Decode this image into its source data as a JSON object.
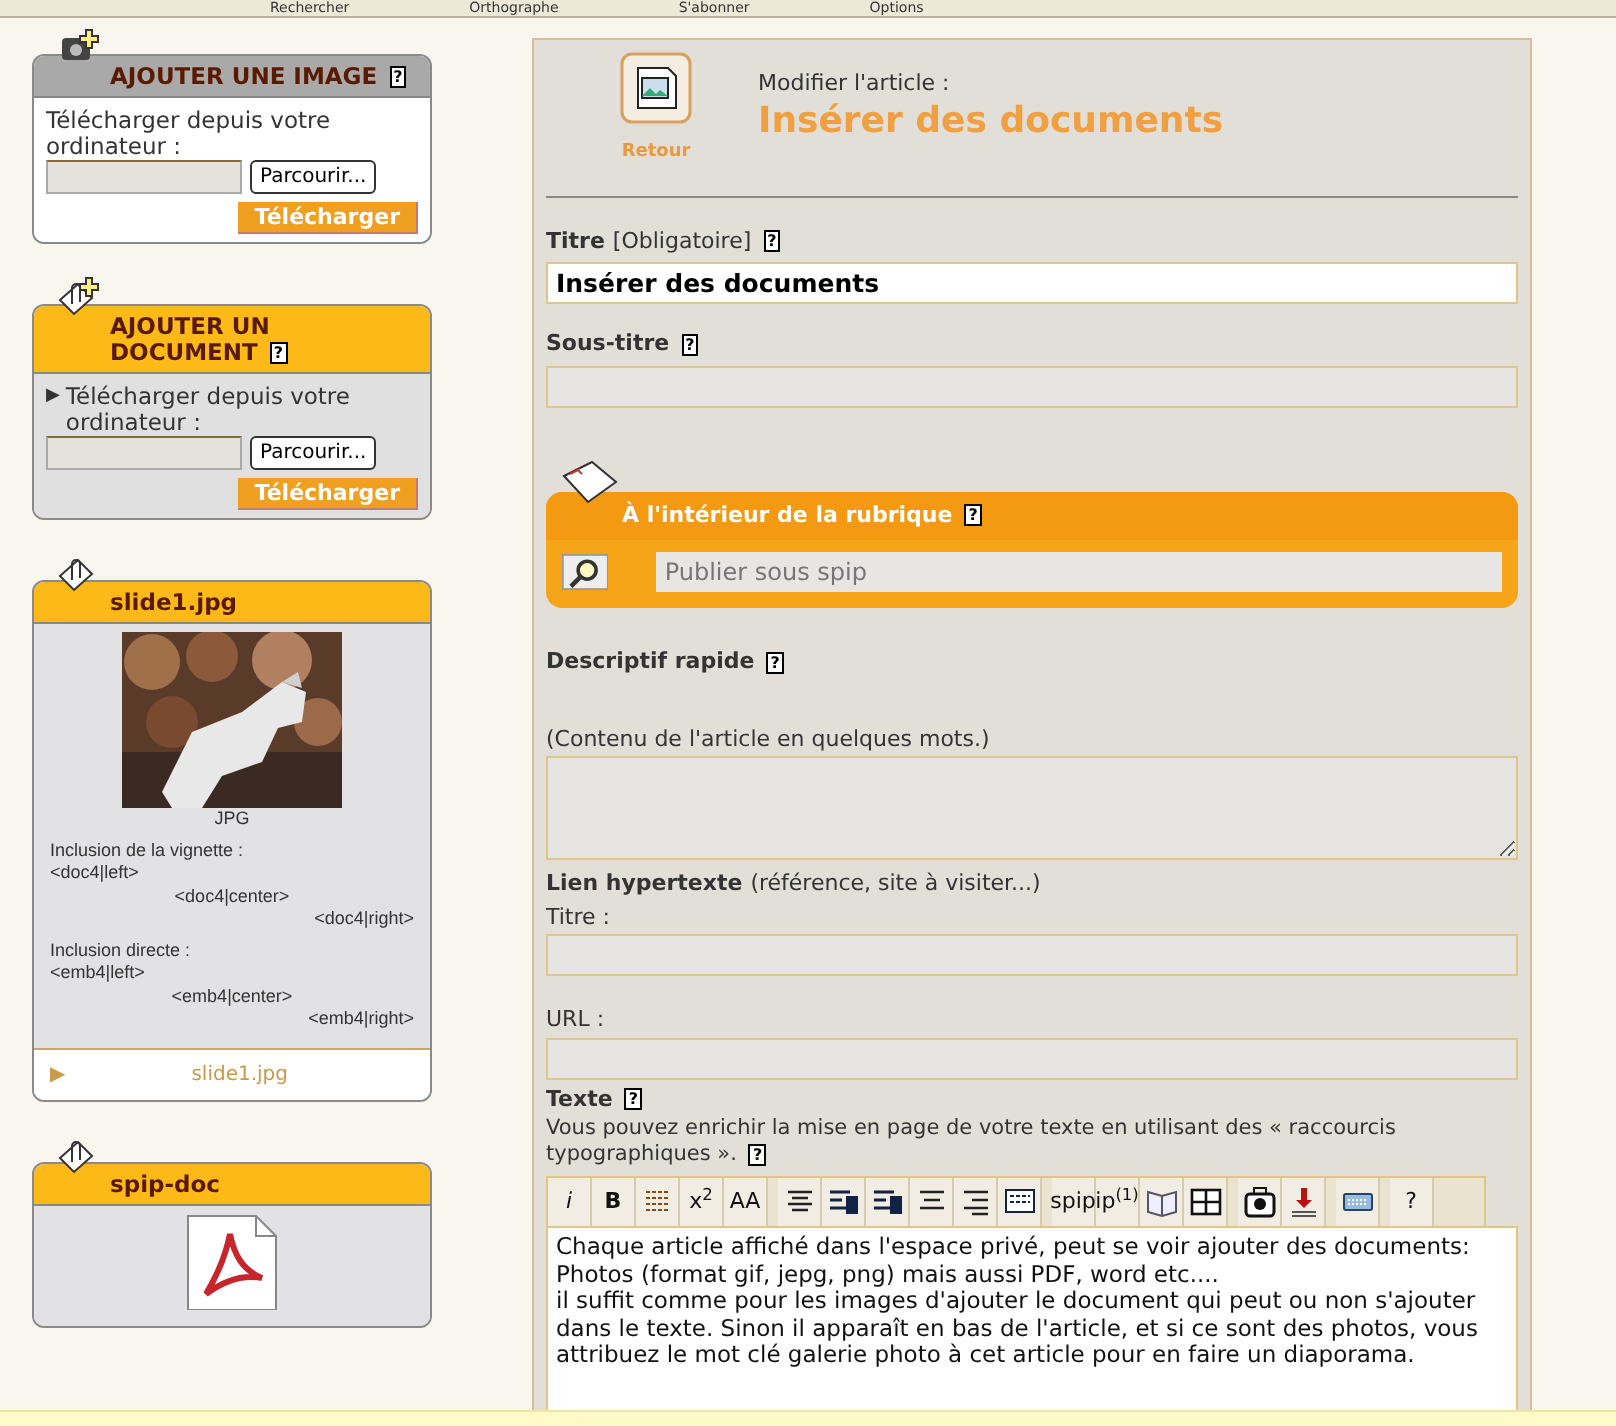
{
  "browser_toolbar": {
    "items": [
      "Rechercher",
      "Orthographe",
      "S'abonner",
      "Options"
    ]
  },
  "sidebar": {
    "boxes": [
      {
        "kind": "upload",
        "title": "AJOUTER UNE IMAGE",
        "help": "?",
        "color": "#a9a9a9",
        "label": "Télécharger depuis votre ordinateur :",
        "browse_button": "Parcourir...",
        "submit_button": "Télécharger"
      },
      {
        "kind": "upload",
        "title": "AJOUTER UN DOCUMENT",
        "help": "?",
        "color": "#fcb918",
        "arrow": "▶",
        "label": "Télécharger depuis votre ordinateur :",
        "browse_button": "Parcourir...",
        "submit_button": "Télécharger"
      },
      {
        "kind": "document",
        "title": "slide1.jpg",
        "color": "#fcb918",
        "thumbnail": {
          "kind": "picture"
        },
        "type_label": "JPG",
        "inclusions": [
          {
            "heading": "Inclusion de la vignette :",
            "codes": [
              "<doc4|left>",
              "<doc4|center>",
              "<doc4|right>"
            ]
          },
          {
            "heading": "Inclusion directe :",
            "codes": [
              "<emb4|left>",
              "<emb4|center>",
              "<emb4|right>"
            ]
          }
        ],
        "link": {
          "arrow": "▶",
          "label": "slide1.jpg"
        }
      },
      {
        "kind": "pdf",
        "title": "spip-doc",
        "color": "#fcb918"
      }
    ]
  },
  "article": {
    "back_label": "Retour",
    "subtitle": "Modifier l'article :",
    "title": "Insérer des documents",
    "title_field": {
      "label": "Titre",
      "note": "[Obligatoire]",
      "help": "?",
      "value": "Insérer des documents"
    },
    "subtitle_field": {
      "label": "Sous-titre",
      "help": "?"
    },
    "section": {
      "label": "À l'intérieur de la rubrique",
      "help": "?",
      "placeholder": "Publier sous spip"
    },
    "summary_field": {
      "label": "Descriptif rapide",
      "help": "?",
      "hint": "(Contenu de l'article en quelques mots.)"
    },
    "link": {
      "label": "Lien hypertexte",
      "note": "(référence, site à visiter...)",
      "title_label": "Titre :",
      "url_label": "URL :"
    },
    "text_field": {
      "label": "Texte",
      "help": "?",
      "hint_lines": [
        "Vous pouvez enrichir la mise en page de votre texte en utilisant des « raccourcis",
        "typographiques »."
      ],
      "hint_help": "?",
      "toolbar": [
        {
          "kind": "text",
          "label": "i"
        },
        {
          "kind": "text",
          "label": "B"
        },
        {
          "kind": "lines"
        },
        {
          "kind": "text",
          "label": "x$^{2}$"
        },
        {
          "kind": "text",
          "label": "AA"
        },
        {
          "kind": "align"
        },
        {
          "kind": "heading"
        },
        {
          "kind": "heading"
        },
        {
          "kind": "center"
        },
        {
          "kind": "right"
        },
        {
          "kind": "frame"
        },
        {
          "kind": "text",
          "label": "spip"
        },
        {
          "kind": "text",
          "label": "ip$^{(1)}$"
        },
        {
          "kind": "book"
        },
        {
          "kind": "table"
        },
        {
          "kind": "tool"
        },
        {
          "kind": "download"
        },
        {
          "kind": "keyboard"
        },
        {
          "kind": "text",
          "label": "?"
        }
      ],
      "value": "Chaque article affiché dans l'espace privé, peut se voir ajouter des documents: Photos (format gif, jepg, png) mais aussi PDF, word etc....\nil suffit comme pour les images d'ajouter le document qui peut ou non s'ajouter dans le texte. Sinon il apparaît en bas de l'article, et si ce sont des photos, vous attribuez le mot clé galerie photo à cet article pour en faire un diaporama."
    }
  }
}
